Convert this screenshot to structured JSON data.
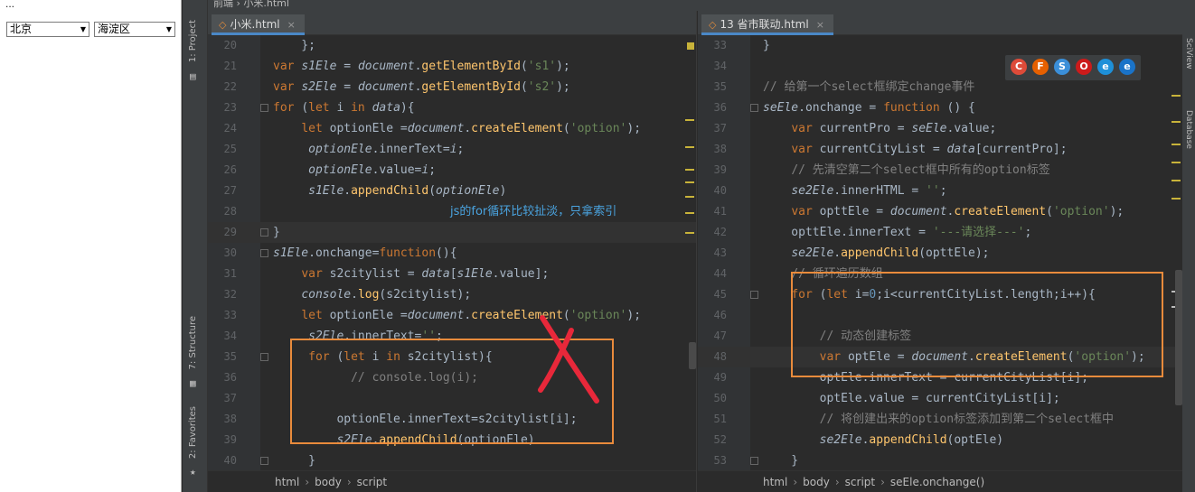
{
  "browser": {
    "title_fragment": "...",
    "select1": "北京",
    "select2": "海淀区"
  },
  "toolstrip": {
    "project_tab": "1: Project",
    "structure_tab": "7: Structure",
    "favorites_tab": "2: Favorites"
  },
  "topbar": {
    "path": "前端 › 小米.html"
  },
  "left_editor": {
    "tab_label": "小米.html",
    "annotation": "js的for循环比较扯淡，只拿索引",
    "breadcrumbs": [
      "html",
      "body",
      "script"
    ],
    "lines": [
      {
        "n": "20",
        "tokens": [
          [
            "",
            "    };"
          ]
        ]
      },
      {
        "n": "21",
        "tokens": [
          [
            "kw",
            "var "
          ],
          [
            "var",
            "s1Ele"
          ],
          [
            "",
            " = "
          ],
          [
            "var",
            "document"
          ],
          [
            "",
            "."
          ],
          [
            "fn",
            "getElementById"
          ],
          [
            "",
            "("
          ],
          [
            "str",
            "'s1'"
          ],
          [
            "",
            ");"
          ]
        ]
      },
      {
        "n": "22",
        "tokens": [
          [
            "kw",
            "var "
          ],
          [
            "var",
            "s2Ele"
          ],
          [
            "",
            " = "
          ],
          [
            "var",
            "document"
          ],
          [
            "",
            "."
          ],
          [
            "fn",
            "getElementById"
          ],
          [
            "",
            "("
          ],
          [
            "str",
            "'s2'"
          ],
          [
            "",
            ");"
          ]
        ]
      },
      {
        "n": "23",
        "tokens": [
          [
            "kw",
            "for "
          ],
          [
            "",
            "("
          ],
          [
            "kw",
            "let "
          ],
          [
            "",
            "i "
          ],
          [
            "kw",
            "in "
          ],
          [
            "var",
            "data"
          ],
          [
            "",
            "){"
          ]
        ]
      },
      {
        "n": "24",
        "tokens": [
          [
            "",
            "    "
          ],
          [
            "kw",
            "let "
          ],
          [
            "",
            "optionEle ="
          ],
          [
            "var",
            "document"
          ],
          [
            "",
            "."
          ],
          [
            "fn",
            "createElement"
          ],
          [
            "",
            "("
          ],
          [
            "str",
            "'option'"
          ],
          [
            "",
            ");"
          ]
        ]
      },
      {
        "n": "25",
        "tokens": [
          [
            "",
            "     "
          ],
          [
            "var",
            "optionEle"
          ],
          [
            "",
            "."
          ],
          [
            "",
            "innerText="
          ],
          [
            "var",
            "i"
          ],
          [
            "",
            ";"
          ]
        ]
      },
      {
        "n": "26",
        "tokens": [
          [
            "",
            "     "
          ],
          [
            "var",
            "optionEle"
          ],
          [
            "",
            ".value="
          ],
          [
            "var",
            "i"
          ],
          [
            "",
            ";"
          ]
        ]
      },
      {
        "n": "27",
        "tokens": [
          [
            "",
            "     "
          ],
          [
            "var",
            "s1Ele"
          ],
          [
            "",
            "."
          ],
          [
            "fn",
            "appendChild"
          ],
          [
            "",
            "("
          ],
          [
            "var",
            "optionEle"
          ],
          [
            "",
            ")"
          ]
        ]
      },
      {
        "n": "28",
        "tokens": [
          [
            "",
            ""
          ]
        ]
      },
      {
        "n": "29",
        "tokens": [
          [
            "",
            "}"
          ]
        ],
        "hl": true
      },
      {
        "n": "30",
        "tokens": [
          [
            "var",
            "s1Ele"
          ],
          [
            "",
            ".onchange="
          ],
          [
            "kw",
            "function"
          ],
          [
            "",
            "(){"
          ]
        ]
      },
      {
        "n": "31",
        "tokens": [
          [
            "",
            "    "
          ],
          [
            "kw",
            "var "
          ],
          [
            "",
            "s2citylist = "
          ],
          [
            "var",
            "data"
          ],
          [
            "",
            "["
          ],
          [
            "var",
            "s1Ele"
          ],
          [
            "",
            ".value];"
          ]
        ]
      },
      {
        "n": "32",
        "tokens": [
          [
            "",
            "    "
          ],
          [
            "var",
            "console"
          ],
          [
            "",
            "."
          ],
          [
            "fn",
            "log"
          ],
          [
            "",
            "(s2citylist);"
          ]
        ]
      },
      {
        "n": "33",
        "tokens": [
          [
            "",
            "    "
          ],
          [
            "kw",
            "let "
          ],
          [
            "",
            "optionEle ="
          ],
          [
            "var",
            "document"
          ],
          [
            "",
            "."
          ],
          [
            "fn",
            "createElement"
          ],
          [
            "",
            "("
          ],
          [
            "str",
            "'option'"
          ],
          [
            "",
            ");"
          ]
        ]
      },
      {
        "n": "34",
        "tokens": [
          [
            "",
            "     "
          ],
          [
            "var",
            "s2Ele"
          ],
          [
            "",
            ".innerText="
          ],
          [
            "str",
            "''"
          ],
          [
            "",
            ";"
          ]
        ]
      },
      {
        "n": "35",
        "tokens": [
          [
            "",
            "     "
          ],
          [
            "kw",
            "for "
          ],
          [
            "",
            "("
          ],
          [
            "kw",
            "let "
          ],
          [
            "",
            "i "
          ],
          [
            "kw",
            "in "
          ],
          [
            "",
            "s2citylist){"
          ]
        ]
      },
      {
        "n": "36",
        "tokens": [
          [
            "",
            "           "
          ],
          [
            "cm",
            "// console.log(i);"
          ]
        ]
      },
      {
        "n": "37",
        "tokens": [
          [
            "",
            ""
          ]
        ]
      },
      {
        "n": "38",
        "tokens": [
          [
            "",
            "         optionEle.innerText=s2citylist[i];"
          ]
        ]
      },
      {
        "n": "39",
        "tokens": [
          [
            "",
            "         "
          ],
          [
            "var",
            "s2Ele"
          ],
          [
            "",
            "."
          ],
          [
            "fn",
            "appendChild"
          ],
          [
            "",
            "(optionEle)"
          ]
        ]
      },
      {
        "n": "40",
        "tokens": [
          [
            "",
            "     }"
          ]
        ]
      }
    ]
  },
  "right_editor": {
    "tab_label": "13 省市联动.html",
    "breadcrumbs": [
      "html",
      "body",
      "script",
      "seEle.onchange()"
    ],
    "lines": [
      {
        "n": "33",
        "tokens": [
          [
            "",
            "}"
          ]
        ]
      },
      {
        "n": "34",
        "tokens": [
          [
            "",
            ""
          ]
        ]
      },
      {
        "n": "35",
        "tokens": [
          [
            "cm",
            "// 给第一个select框绑定change事件"
          ]
        ]
      },
      {
        "n": "36",
        "tokens": [
          [
            "var",
            "seEle"
          ],
          [
            "",
            ".onchange = "
          ],
          [
            "kw",
            "function "
          ],
          [
            "",
            "() {"
          ]
        ]
      },
      {
        "n": "37",
        "tokens": [
          [
            "",
            "    "
          ],
          [
            "kw",
            "var "
          ],
          [
            "",
            "currentPro = "
          ],
          [
            "var",
            "seEle"
          ],
          [
            "",
            ".value;"
          ]
        ]
      },
      {
        "n": "38",
        "tokens": [
          [
            "",
            "    "
          ],
          [
            "kw",
            "var "
          ],
          [
            "",
            "currentCityList = "
          ],
          [
            "var",
            "data"
          ],
          [
            "",
            "[currentPro];"
          ]
        ]
      },
      {
        "n": "39",
        "tokens": [
          [
            "",
            "    "
          ],
          [
            "cm",
            "// 先清空第二个select框中所有的option标签"
          ]
        ]
      },
      {
        "n": "40",
        "tokens": [
          [
            "",
            "    "
          ],
          [
            "var",
            "se2Ele"
          ],
          [
            "",
            ".innerHTML = "
          ],
          [
            "str",
            "''"
          ],
          [
            "",
            ";"
          ]
        ]
      },
      {
        "n": "41",
        "tokens": [
          [
            "",
            "    "
          ],
          [
            "kw",
            "var "
          ],
          [
            "",
            "opttEle = "
          ],
          [
            "var",
            "document"
          ],
          [
            "",
            "."
          ],
          [
            "fn",
            "createElement"
          ],
          [
            "",
            "("
          ],
          [
            "str",
            "'option'"
          ],
          [
            "",
            ");"
          ]
        ]
      },
      {
        "n": "42",
        "tokens": [
          [
            "",
            "    opttEle.innerText = "
          ],
          [
            "str",
            "'---请选择---'"
          ],
          [
            "",
            ";"
          ]
        ]
      },
      {
        "n": "43",
        "tokens": [
          [
            "",
            "    "
          ],
          [
            "var",
            "se2Ele"
          ],
          [
            "",
            "."
          ],
          [
            "fn",
            "appendChild"
          ],
          [
            "",
            "(opttEle);"
          ]
        ]
      },
      {
        "n": "44",
        "tokens": [
          [
            "",
            "    "
          ],
          [
            "cm",
            "// 循环遍历数组"
          ]
        ]
      },
      {
        "n": "45",
        "tokens": [
          [
            "",
            "    "
          ],
          [
            "kw",
            "for "
          ],
          [
            "",
            "("
          ],
          [
            "kw",
            "let "
          ],
          [
            "",
            "i="
          ],
          [
            "num",
            "0"
          ],
          [
            "",
            ";i<currentCityList.length;i++){"
          ]
        ]
      },
      {
        "n": "46",
        "tokens": [
          [
            "",
            ""
          ]
        ]
      },
      {
        "n": "47",
        "tokens": [
          [
            "",
            "        "
          ],
          [
            "cm",
            "// 动态创建标签"
          ]
        ]
      },
      {
        "n": "48",
        "tokens": [
          [
            "",
            "        "
          ],
          [
            "kw",
            "var "
          ],
          [
            "",
            "optEle = "
          ],
          [
            "var",
            "document"
          ],
          [
            "",
            "."
          ],
          [
            "fn",
            "createElement"
          ],
          [
            "",
            "("
          ],
          [
            "str",
            "'option'"
          ],
          [
            "",
            ");"
          ]
        ],
        "hl": true
      },
      {
        "n": "49",
        "tokens": [
          [
            "",
            "        optEle.innerText = currentCityList[i];"
          ]
        ]
      },
      {
        "n": "50",
        "tokens": [
          [
            "",
            "        optEle.value = currentCityList[i];"
          ]
        ]
      },
      {
        "n": "51",
        "tokens": [
          [
            "",
            "        "
          ],
          [
            "cm",
            "// 将创建出来的option标签添加到第二个select框中"
          ]
        ]
      },
      {
        "n": "52",
        "tokens": [
          [
            "",
            "        "
          ],
          [
            "var",
            "se2Ele"
          ],
          [
            "",
            "."
          ],
          [
            "fn",
            "appendChild"
          ],
          [
            "",
            "(optEle)"
          ]
        ]
      },
      {
        "n": "53",
        "tokens": [
          [
            "",
            "    }"
          ]
        ]
      }
    ]
  },
  "browser_icons": [
    {
      "name": "chrome-icon",
      "glyph": "C",
      "color": "#dd4b39"
    },
    {
      "name": "firefox-icon",
      "glyph": "F",
      "color": "#e66000"
    },
    {
      "name": "safari-icon",
      "glyph": "S",
      "color": "#3b8fd9"
    },
    {
      "name": "opera-icon",
      "glyph": "O",
      "color": "#cc1b1b"
    },
    {
      "name": "ie-icon",
      "glyph": "e",
      "color": "#1e90d8"
    },
    {
      "name": "edge-icon",
      "glyph": "e",
      "color": "#1a73c8"
    }
  ],
  "right_strip": {
    "tab1": "SciView",
    "tab2": "Database"
  },
  "colors": {
    "accent": "#4a88c7",
    "box": "#e98b3c",
    "cross": "#e8283a"
  }
}
